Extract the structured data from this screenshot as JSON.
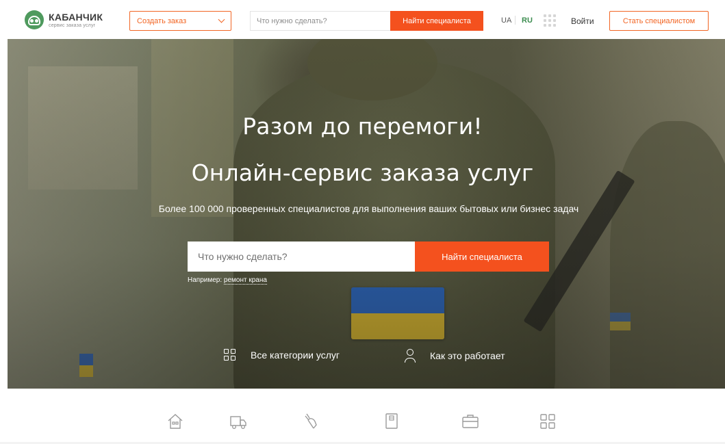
{
  "header": {
    "logo_title": "КАБАНЧИК",
    "logo_subtitle": "сервис заказа услуг",
    "create_order_label": "Создать заказ",
    "search_placeholder": "Что нужно сделать?",
    "search_button": "Найти специалиста",
    "lang_ua": "UA",
    "lang_ru": "RU",
    "active_lang": "RU",
    "login_label": "Войти",
    "become_specialist_label": "Стать специалистом"
  },
  "hero": {
    "title": "Разом до перемоги!",
    "subtitle": "Онлайн-сервис заказа услуг",
    "description": "Более 100 000 проверенных специалистов для выполнения ваших бытовых или бизнес задач",
    "search_placeholder": "Что нужно сделать?",
    "search_button": "Найти специалиста",
    "example_prefix": "Например:",
    "example_link": "ремонт крана",
    "all_categories_label": "Все категории услуг",
    "how_it_works_label": "Как это работает"
  },
  "categories": [
    {
      "icon": "house-icon"
    },
    {
      "icon": "truck-icon"
    },
    {
      "icon": "hand-pointer-icon"
    },
    {
      "icon": "document-icon"
    },
    {
      "icon": "briefcase-icon"
    },
    {
      "icon": "grid-icon"
    }
  ],
  "colors": {
    "accent": "#f4511e",
    "brand_green": "#4f9a5e",
    "flag_blue": "#2f6fd0",
    "flag_yellow": "#ebc634"
  }
}
